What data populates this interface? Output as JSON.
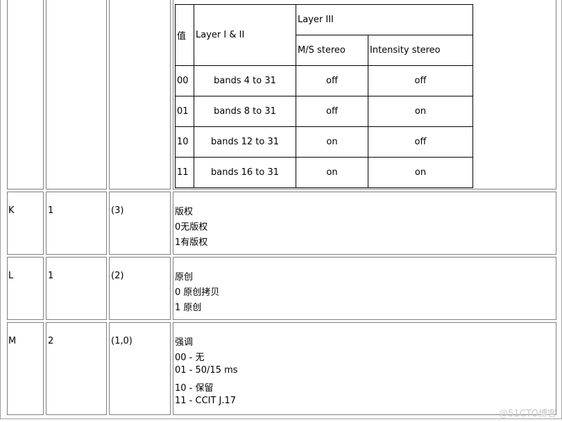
{
  "top_row": {
    "inner_table": {
      "header": {
        "value_col": "值",
        "layer12_col": "Layer I & II",
        "layer3_group": "Layer III",
        "ms_stereo": "M/S stereo",
        "intensity_stereo": "Intensity stereo"
      },
      "rows": [
        {
          "value": "00",
          "layer12": "bands 4 to 31",
          "ms": "off",
          "intensity": "off"
        },
        {
          "value": "01",
          "layer12": "bands 8 to 31",
          "ms": "off",
          "intensity": "on"
        },
        {
          "value": "10",
          "layer12": "bands 12 to 31",
          "ms": "on",
          "intensity": "off"
        },
        {
          "value": "11",
          "layer12": "bands 16 to 31",
          "ms": "on",
          "intensity": "on"
        }
      ]
    }
  },
  "rows": [
    {
      "id": "K",
      "len": "1",
      "pos": "(3)",
      "desc": [
        "版权",
        "0无版权",
        "1有版权"
      ]
    },
    {
      "id": "L",
      "len": "1",
      "pos": "(2)",
      "desc": [
        "原创",
        "0 原创拷贝",
        "1 原创"
      ]
    },
    {
      "id": "M",
      "len": "2",
      "pos": "(1,0)",
      "desc": [
        "强调",
        "00 - 无",
        "01 - 50/15 ms",
        "10 - 保留",
        "11 - CCIT J.17"
      ]
    }
  ],
  "watermark": "@51CTO博客"
}
